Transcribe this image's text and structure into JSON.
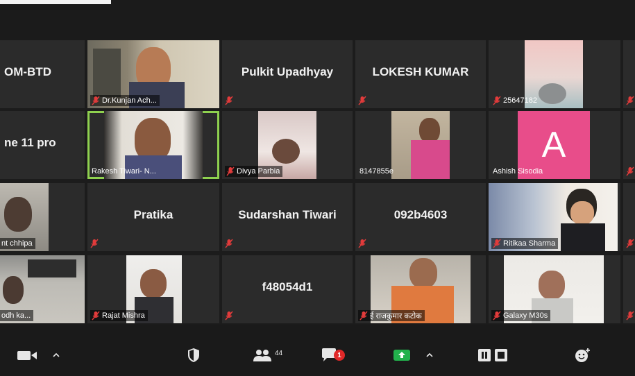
{
  "participants": {
    "row1": {
      "t1_name": "OM-BTD",
      "t2_label": "Dr.Kunjan Ach...",
      "t3_name": "Pulkit Upadhyay",
      "t4_name": "LOKESH KUMAR",
      "t5_label": "25647182"
    },
    "row2": {
      "t1_name": "ne 11 pro",
      "t2_label": "Rakesh Tiwari- N...",
      "t3_label": "Divya Parbia",
      "t4_label": "8147855e",
      "t5_label": "Ashish Sisodia",
      "t5_avatar": "A"
    },
    "row3": {
      "t1_label": "nt chhipa",
      "t2_name": "Pratika",
      "t3_name": "Sudarshan Tiwari",
      "t4_name": "092b4603",
      "t5_label": "Ritikaa Sharma"
    },
    "row4": {
      "t1_label": "odh ka...",
      "t2_label": "Rajat Mishra",
      "t3_name": "f48054d1",
      "t4_label": "ई राजकुमार कटोक",
      "t5_label": "Galaxy M30s"
    }
  },
  "toolbar": {
    "participants_count": "44",
    "chat_badge": "1"
  },
  "colors": {
    "speaking_outline": "#8fd14f",
    "muted_mic": "#e23b3b",
    "avatar_bg": "#e84d8a",
    "share_green": "#22b14c"
  }
}
